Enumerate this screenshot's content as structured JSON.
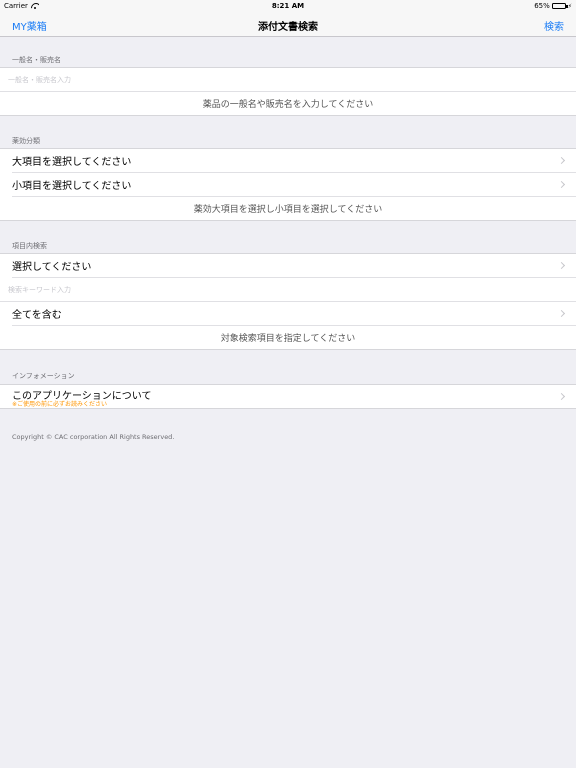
{
  "status": {
    "carrier": "Carrier",
    "time": "8:21 AM",
    "battery": "65%",
    "battery_level": 0.65
  },
  "nav": {
    "left": "MY薬箱",
    "title": "添付文書検索",
    "right": "検索"
  },
  "section_name": {
    "header": "一般名・販売名",
    "input_placeholder": "一般名・販売名入力",
    "hint": "薬品の一般名や販売名を入力してください"
  },
  "section_category": {
    "header": "薬効分類",
    "major": "大項目を選択してください",
    "minor": "小項目を選択してください",
    "hint": "薬効大項目を選択し小項目を選択してください"
  },
  "section_field": {
    "header": "項目内検索",
    "select": "選択してください",
    "keyword_placeholder": "検索キーワード入力",
    "match": "全てを含む",
    "hint": "対象検索項目を指定してください"
  },
  "section_info": {
    "header": "インフォメーション",
    "about": "このアプリケーションについて",
    "about_note": "※ご使用の前に必ずお読みください"
  },
  "footer": {
    "copyright": "Copyright © CAC corporation All Rights Reserved."
  }
}
